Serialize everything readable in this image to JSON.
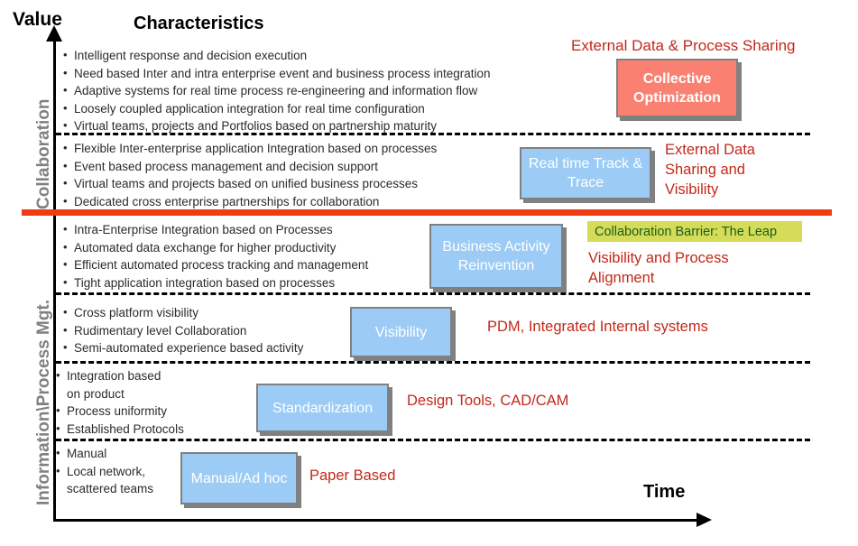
{
  "axes": {
    "value_label": "Value",
    "time_label": "Time",
    "characteristics_header": "Characteristics",
    "side_labels": {
      "upper": "Collaboration",
      "lower": "Information\\Process Mgt."
    }
  },
  "colors": {
    "leap_bar": "#F03C12",
    "stage_blue": "#9CCCF5",
    "stage_salmon": "#FA8072",
    "barrier_background": "#D4DC58",
    "barrier_text": "#1B5E20",
    "annotation_red": "#C3281A",
    "side_label_gray": "#808080",
    "box_border_gray": "#808080"
  },
  "barrier": {
    "label": "Collaboration Barrier: The Leap"
  },
  "levels": [
    {
      "id": "collective-optimization",
      "bullets": [
        "Intelligent response and decision execution",
        "Need based Inter and intra enterprise event and business process integration",
        "Adaptive systems for real time process re-engineering and information flow",
        "Loosely coupled application integration for real time configuration",
        "Virtual teams, projects and Portfolios based on partnership maturity"
      ],
      "box_label": "Collective Optimization",
      "box_color": "salmon",
      "annotation": "External Data & Process Sharing"
    },
    {
      "id": "real-time-track-trace",
      "bullets": [
        "Flexible Inter-enterprise application Integration based on processes",
        "Event based process management and decision support",
        "Virtual teams and projects based on unified business processes",
        "Dedicated cross enterprise partnerships for collaboration"
      ],
      "box_label": "Real time Track & Trace",
      "box_color": "blue",
      "annotation": "External Data Sharing and Visibility"
    },
    {
      "id": "business-activity-reinvention",
      "bullets": [
        "Intra-Enterprise Integration based on Processes",
        "Automated data exchange for higher productivity",
        "Efficient automated process tracking and management",
        "Tight application integration based on processes"
      ],
      "box_label": "Business Activity Reinvention",
      "box_color": "blue",
      "annotation": "Visibility and Process Alignment"
    },
    {
      "id": "visibility",
      "bullets": [
        "Cross platform visibility",
        "Rudimentary level Collaboration",
        "Semi-automated experience based activity"
      ],
      "box_label": "Visibility",
      "box_color": "blue",
      "annotation": "PDM, Integrated Internal systems"
    },
    {
      "id": "standardization",
      "bullets": [
        "Integration based on product",
        "Process uniformity",
        "Established Protocols"
      ],
      "box_label": "Standardization",
      "box_color": "blue",
      "annotation": "Design Tools, CAD/CAM"
    },
    {
      "id": "manual-adhoc",
      "bullets": [
        "Manual",
        "Local network, scattered teams"
      ],
      "box_label": "Manual/Ad hoc",
      "box_color": "blue",
      "annotation": "Paper Based"
    }
  ]
}
